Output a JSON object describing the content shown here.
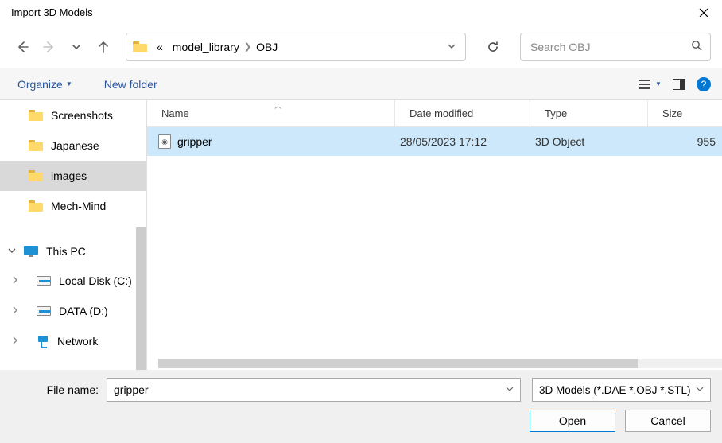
{
  "title": "Import 3D Models",
  "breadcrumb": {
    "prefix": "«",
    "parts": [
      "model_library",
      "OBJ"
    ]
  },
  "search": {
    "placeholder": "Search OBJ"
  },
  "toolbar": {
    "organize": "Organize",
    "newfolder": "New folder"
  },
  "sidebar": {
    "quick": [
      {
        "label": "Screenshots",
        "type": "folder"
      },
      {
        "label": "Japanese",
        "type": "folder"
      },
      {
        "label": "images",
        "type": "folder",
        "selected": true
      },
      {
        "label": "Mech-Mind",
        "type": "folder"
      }
    ],
    "pc": {
      "label": "This PC"
    },
    "drives": [
      {
        "label": "Local Disk (C:)",
        "type": "disk"
      },
      {
        "label": "DATA (D:)",
        "type": "disk"
      },
      {
        "label": "Network",
        "type": "net"
      }
    ]
  },
  "columns": {
    "name": "Name",
    "date": "Date modified",
    "type": "Type",
    "size": "Size"
  },
  "files": [
    {
      "name": "gripper",
      "date": "28/05/2023 17:12",
      "type": "3D Object",
      "size": "955"
    }
  ],
  "footer": {
    "filename_label": "File name:",
    "filename_value": "gripper",
    "filter": "3D Models (*.DAE *.OBJ *.STL)",
    "open": "Open",
    "cancel": "Cancel"
  }
}
